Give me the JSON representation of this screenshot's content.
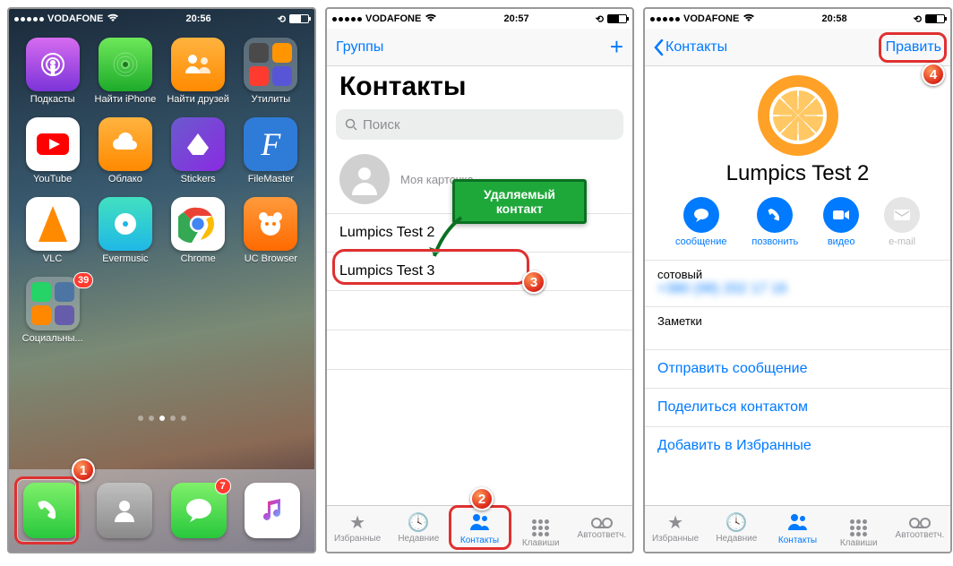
{
  "status": {
    "carrier": "VODAFONE",
    "time1": "20:56",
    "time2": "20:57",
    "time3": "20:58"
  },
  "home": {
    "apps": {
      "podcasts": "Подкасты",
      "findiphone": "Найти iPhone",
      "findfriends": "Найти друзей",
      "utilities": "Утилиты",
      "youtube": "YouTube",
      "cloud": "Облако",
      "stickers": "Stickers",
      "filemaster": "FileMaster",
      "vlc": "VLC",
      "evermusic": "Evermusic",
      "chrome": "Chrome",
      "ucbrowser": "UC Browser",
      "social": "Социальны..."
    },
    "badges": {
      "social": "39",
      "messages": "7"
    }
  },
  "contacts": {
    "nav_groups": "Группы",
    "title": "Контакты",
    "search_placeholder": "Поиск",
    "mycard": "Моя карточка",
    "row1": "Lumpics Test 2",
    "row2": "Lumpics Test 3"
  },
  "tabs": {
    "favorites": "Избранные",
    "recents": "Недавние",
    "contacts": "Контакты",
    "keypad": "Клавиши",
    "voicemail": "Автоответч."
  },
  "card": {
    "back": "Контакты",
    "edit": "Править",
    "name": "Lumpics Test 2",
    "actions": {
      "message": "сообщение",
      "call": "позвонить",
      "video": "видео",
      "email": "e-mail"
    },
    "phone_label": "сотовый",
    "phone_value": "+380 (98) 202 17 16",
    "notes_label": "Заметки",
    "send_message": "Отправить сообщение",
    "share": "Поделиться контактом",
    "add_fav": "Добавить в Избранные"
  },
  "annotations": {
    "callout": "Удаляемый контакт",
    "n1": "1",
    "n2": "2",
    "n3": "3",
    "n4": "4"
  }
}
